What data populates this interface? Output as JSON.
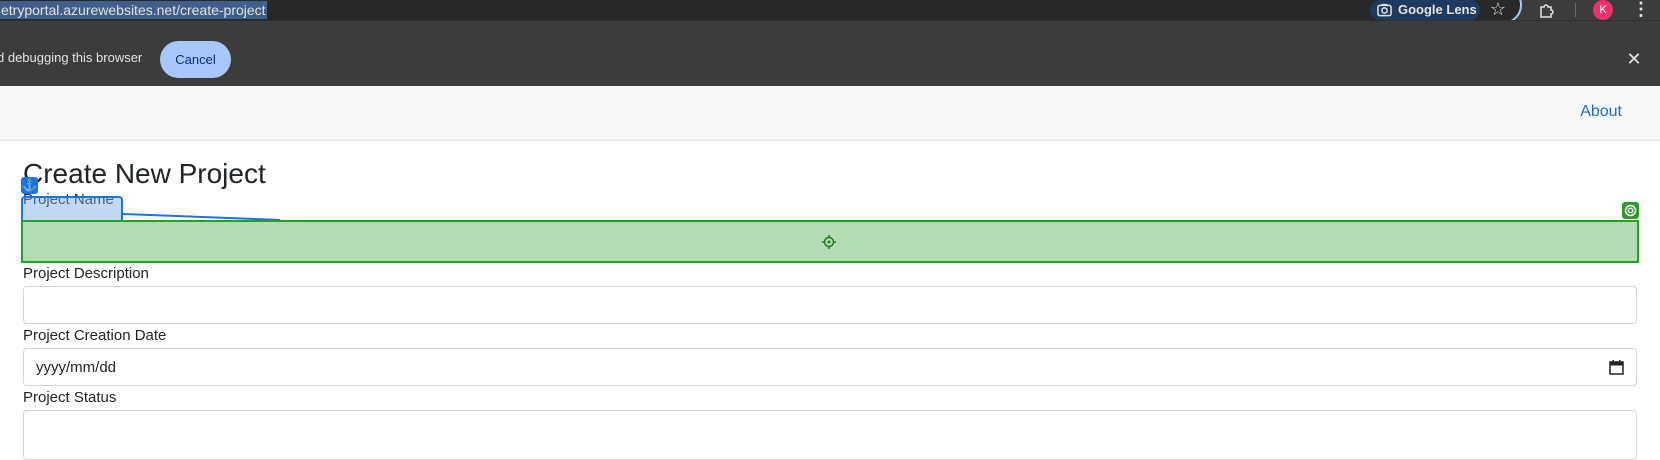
{
  "browser": {
    "url": "etryportal.azurewebsites.net/create-project",
    "lens_label": "Google Lens",
    "profile_initial": "K",
    "icons": [
      "google-lens-icon",
      "bookmark-star-icon",
      "extensions-icon",
      "kebab-menu-icon"
    ]
  },
  "infobar": {
    "message": "d debugging this browser",
    "cancel_label": "Cancel",
    "close_glyph": "✕"
  },
  "navbar": {
    "about_label": "About"
  },
  "form": {
    "title": "Create New Project",
    "fields": [
      {
        "label": "Project Name",
        "value": ""
      },
      {
        "label": "Project Description",
        "value": ""
      },
      {
        "label": "Project Creation Date",
        "value": "yyyy/mm/dd"
      },
      {
        "label": "Project Status",
        "value": ""
      }
    ]
  },
  "overlay": {
    "anchor_glyph": "⚓",
    "anchor_color": "#1a73e8",
    "target_color": "#22a322"
  }
}
